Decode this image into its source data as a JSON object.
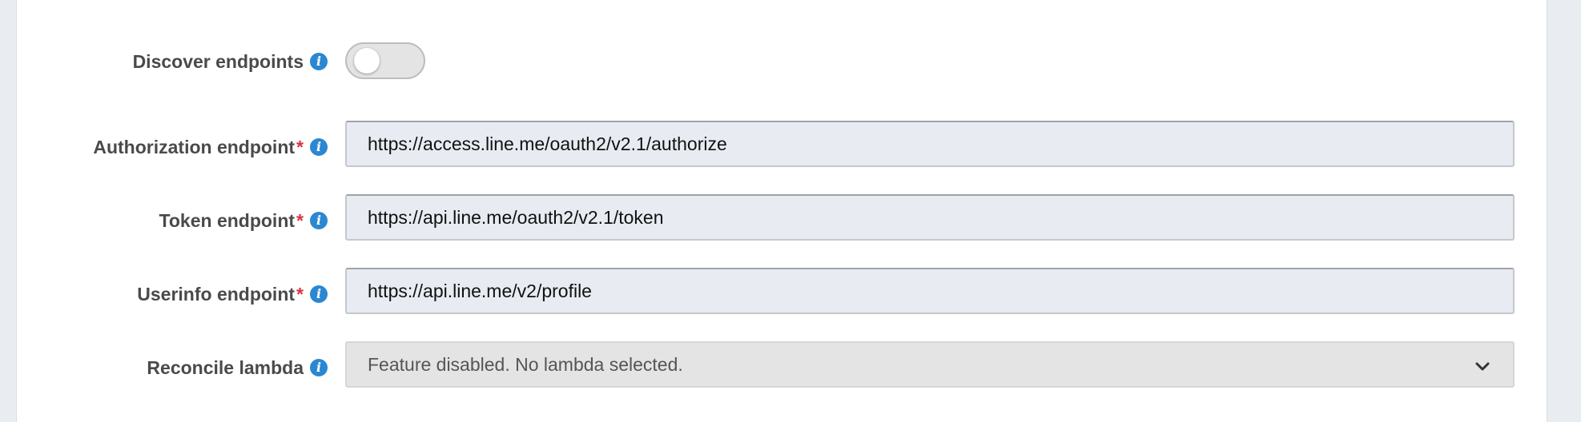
{
  "form": {
    "discover": {
      "label": "Discover endpoints",
      "enabled": false,
      "info_icon": "info-icon"
    },
    "authorization": {
      "label": "Authorization endpoint",
      "required_mark": "*",
      "value": "https://access.line.me/oauth2/v2.1/authorize",
      "info_icon": "info-icon"
    },
    "token": {
      "label": "Token endpoint",
      "required_mark": "*",
      "value": "https://api.line.me/oauth2/v2.1/token",
      "info_icon": "info-icon"
    },
    "userinfo": {
      "label": "Userinfo endpoint",
      "required_mark": "*",
      "value": "https://api.line.me/v2/profile",
      "info_icon": "info-icon"
    },
    "reconcile": {
      "label": "Reconcile lambda",
      "value": "Feature disabled. No lambda selected.",
      "info_icon": "info-icon",
      "dropdown_icon": "chevron-down-icon"
    }
  },
  "colors": {
    "info": "#2b87d1",
    "required": "#d9333f",
    "label": "#4a4a4a",
    "field_bg": "#e8ecf2",
    "disabled_bg": "#e4e4e4"
  }
}
